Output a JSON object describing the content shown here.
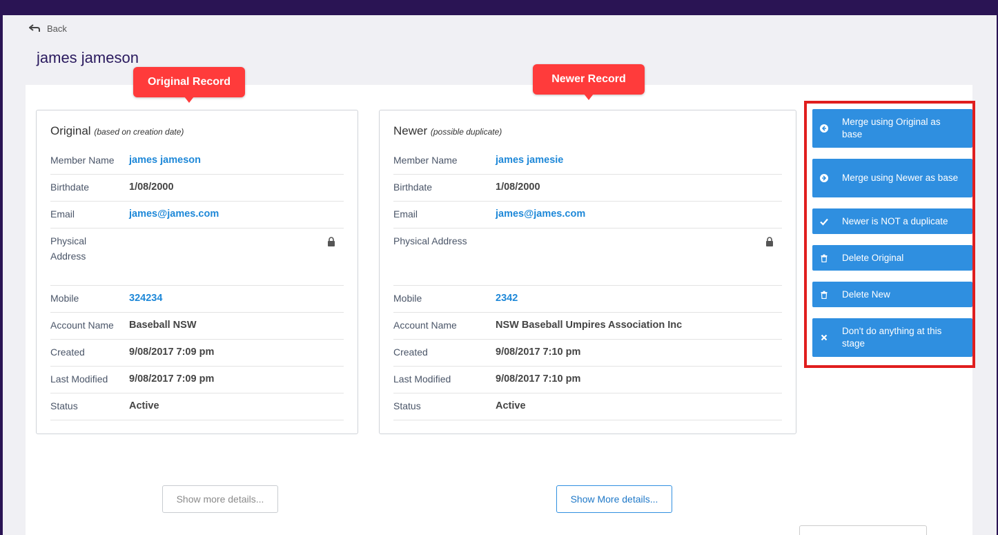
{
  "nav": {
    "back_label": "Back"
  },
  "page": {
    "title": "james jameson"
  },
  "callouts": {
    "original": "Original Record",
    "newer": "Newer Record"
  },
  "original": {
    "title": "Original",
    "subtitle": "(based on creation date)",
    "fields": {
      "member_name": {
        "label": "Member Name",
        "value": "james jameson"
      },
      "birthdate": {
        "label": "Birthdate",
        "value": "1/08/2000"
      },
      "email": {
        "label": "Email",
        "value": "james@james.com"
      },
      "physical_address": {
        "label": "Physical Address",
        "value": ""
      },
      "mobile": {
        "label": "Mobile",
        "value": "324234"
      },
      "account_name": {
        "label": "Account Name",
        "value": "Baseball NSW"
      },
      "created": {
        "label": "Created",
        "value": "9/08/2017 7:09 pm"
      },
      "last_modified": {
        "label": "Last Modified",
        "value": "9/08/2017 7:09 pm"
      },
      "status": {
        "label": "Status",
        "value": "Active"
      }
    },
    "show_more_label": "Show more details..."
  },
  "newer": {
    "title": "Newer",
    "subtitle": "(possible duplicate)",
    "fields": {
      "member_name": {
        "label": "Member Name",
        "value": "james jamesie"
      },
      "birthdate": {
        "label": "Birthdate",
        "value": "1/08/2000"
      },
      "email": {
        "label": "Email",
        "value": "james@james.com"
      },
      "physical_address": {
        "label": "Physical Address",
        "value": ""
      },
      "mobile": {
        "label": "Mobile",
        "value": "2342"
      },
      "account_name": {
        "label": "Account Name",
        "value": "NSW Baseball Umpires Association Inc"
      },
      "created": {
        "label": "Created",
        "value": "9/08/2017 7:10 pm"
      },
      "last_modified": {
        "label": "Last Modified",
        "value": "9/08/2017 7:10 pm"
      },
      "status": {
        "label": "Status",
        "value": "Active"
      }
    },
    "show_more_label": "Show More details..."
  },
  "actions": {
    "merge_original": {
      "label": "Merge using Original as base",
      "icon": "arrow-left-circle-icon"
    },
    "merge_newer": {
      "label": "Merge using Newer as base",
      "icon": "arrow-right-circle-icon"
    },
    "not_duplicate": {
      "label": "Newer is NOT a duplicate",
      "icon": "check-icon"
    },
    "delete_original": {
      "label": "Delete Original",
      "icon": "trash-icon"
    },
    "delete_new": {
      "label": "Delete New",
      "icon": "trash-icon"
    },
    "do_nothing": {
      "label": "Don't do anything at this stage",
      "icon": "close-icon"
    }
  },
  "colors": {
    "frame": "#2a1454",
    "accent": "#2f8fe0",
    "link": "#1e88d8",
    "callout": "#ff3b3b",
    "highlight_border": "#e01e1e"
  }
}
